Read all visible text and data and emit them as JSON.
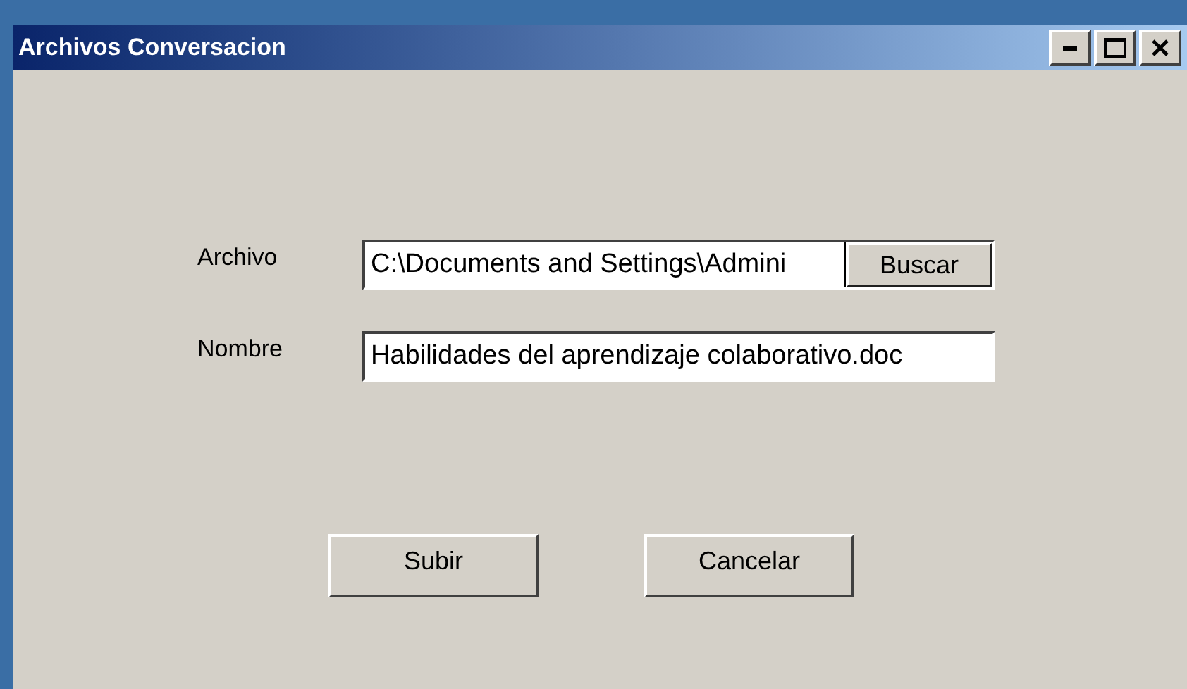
{
  "window": {
    "title": "Archivos Conversacion"
  },
  "fields": [
    {
      "label": "Archivo",
      "value": "C:\\Documents and Settings\\Admini",
      "button": "Buscar"
    },
    {
      "label": "Nombre",
      "value": "Habilidades del aprendizaje colaborativo.doc"
    }
  ],
  "buttons": [
    "Subir",
    "Cancelar"
  ]
}
